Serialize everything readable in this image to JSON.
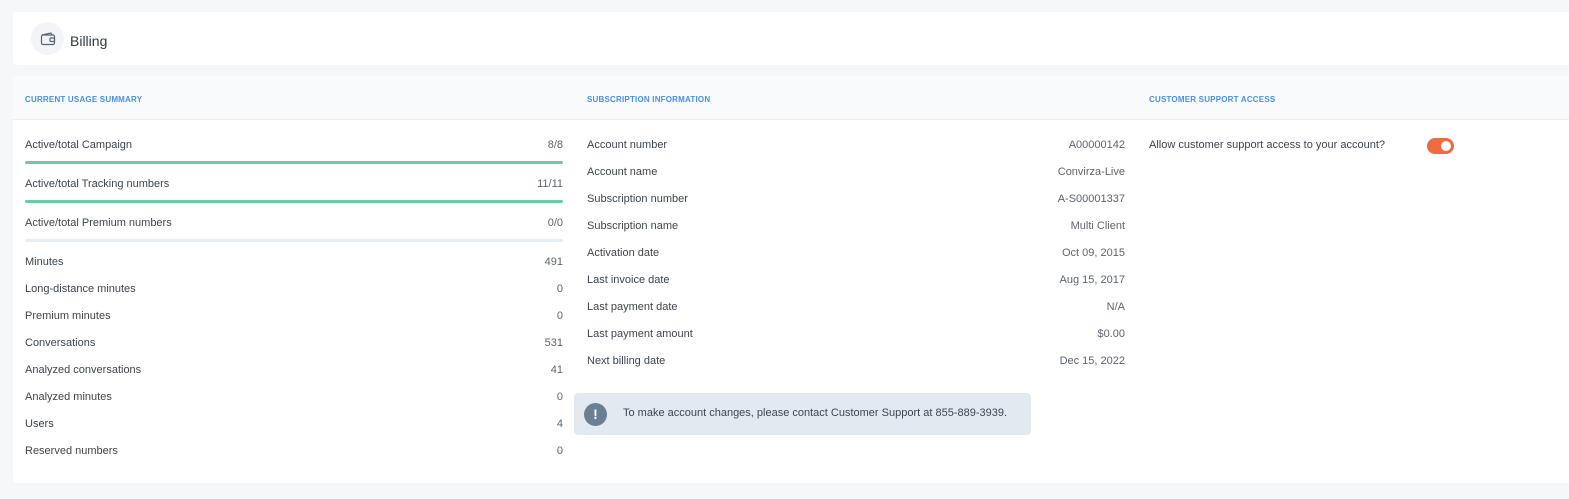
{
  "header": {
    "title": "Billing",
    "icon": "wallet-icon"
  },
  "sections": {
    "usage": "CURRENT USAGE SUMMARY",
    "subscription": "SUBSCRIPTION INFORMATION",
    "support": "CUSTOMER SUPPORT ACCESS"
  },
  "usage": {
    "bars": [
      {
        "label": "Active/total Campaign",
        "value": "8/8",
        "fraction": 1.0
      },
      {
        "label": "Active/total Tracking numbers",
        "value": "11/11",
        "fraction": 1.0
      },
      {
        "label": "Active/total Premium numbers",
        "value": "0/0",
        "fraction": 0.0
      }
    ],
    "rows": [
      {
        "label": "Minutes",
        "value": "491"
      },
      {
        "label": "Long-distance minutes",
        "value": "0"
      },
      {
        "label": "Premium minutes",
        "value": "0"
      },
      {
        "label": "Conversations",
        "value": "531"
      },
      {
        "label": "Analyzed conversations",
        "value": "41"
      },
      {
        "label": "Analyzed minutes",
        "value": "0"
      },
      {
        "label": "Users",
        "value": "4"
      },
      {
        "label": "Reserved numbers",
        "value": "0"
      }
    ]
  },
  "subscription": {
    "rows": [
      {
        "label": "Account number",
        "value": "A00000142"
      },
      {
        "label": "Account name",
        "value": "Convirza-Live"
      },
      {
        "label": "Subscription number",
        "value": "A-S00001337"
      },
      {
        "label": "Subscription name",
        "value": "Multi Client"
      },
      {
        "label": "Activation date",
        "value": "Oct 09, 2015"
      },
      {
        "label": "Last invoice date",
        "value": "Aug 15, 2017"
      },
      {
        "label": "Last payment date",
        "value": "N/A"
      },
      {
        "label": "Last payment amount",
        "value": "$0.00"
      },
      {
        "label": "Next billing date",
        "value": "Dec 15, 2022"
      }
    ],
    "notice": {
      "icon": "alert-icon",
      "icon_glyph": "!",
      "text": "To make account changes, please contact Customer Support at 855-889-3939."
    }
  },
  "support": {
    "question": "Allow customer support access to your account?",
    "enabled": true
  },
  "colors": {
    "accent": "#4a90e2",
    "progress": "#6cc9a0",
    "toggle_on": "#ee6a3f"
  }
}
